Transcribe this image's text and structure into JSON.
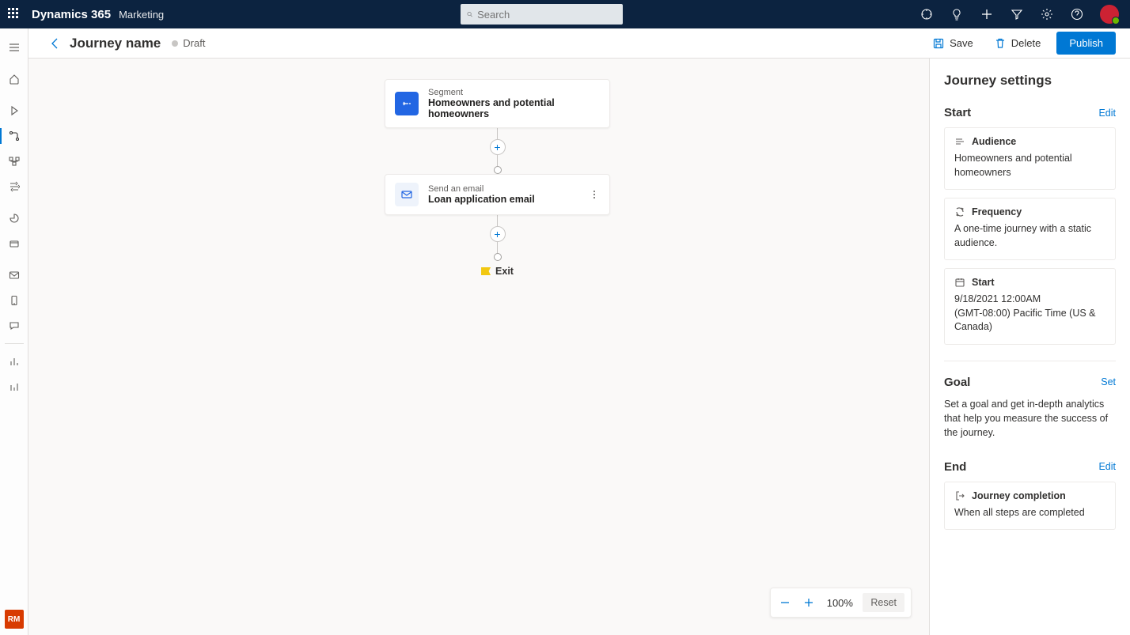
{
  "topbar": {
    "brand": "Dynamics 365",
    "subbrand": "Marketing",
    "search_placeholder": "Search"
  },
  "page": {
    "journey_name": "Journey name",
    "status": "Draft",
    "save_label": "Save",
    "delete_label": "Delete",
    "publish_label": "Publish"
  },
  "flow": {
    "segment_label": "Segment",
    "segment_title": "Homeowners and potential homeowners",
    "email_label": "Send an email",
    "email_title": "Loan application email",
    "exit_label": "Exit"
  },
  "zoom": {
    "level": "100%",
    "reset_label": "Reset"
  },
  "panel": {
    "title": "Journey settings",
    "start": {
      "heading": "Start",
      "edit": "Edit",
      "audience_label": "Audience",
      "audience_value": "Homeowners and potential homeowners",
      "frequency_label": "Frequency",
      "frequency_value": "A one-time journey with a static audience.",
      "start_label": "Start",
      "start_time": "9/18/2021 12:00AM",
      "start_tz": "(GMT-08:00) Pacific Time (US & Canada)"
    },
    "goal": {
      "heading": "Goal",
      "set": "Set",
      "desc": "Set a goal and get in-depth analytics that help you measure the success of the journey."
    },
    "end": {
      "heading": "End",
      "edit": "Edit",
      "completion_label": "Journey completion",
      "completion_value": "When all steps are completed"
    }
  },
  "leftrail_bottom": "RM"
}
